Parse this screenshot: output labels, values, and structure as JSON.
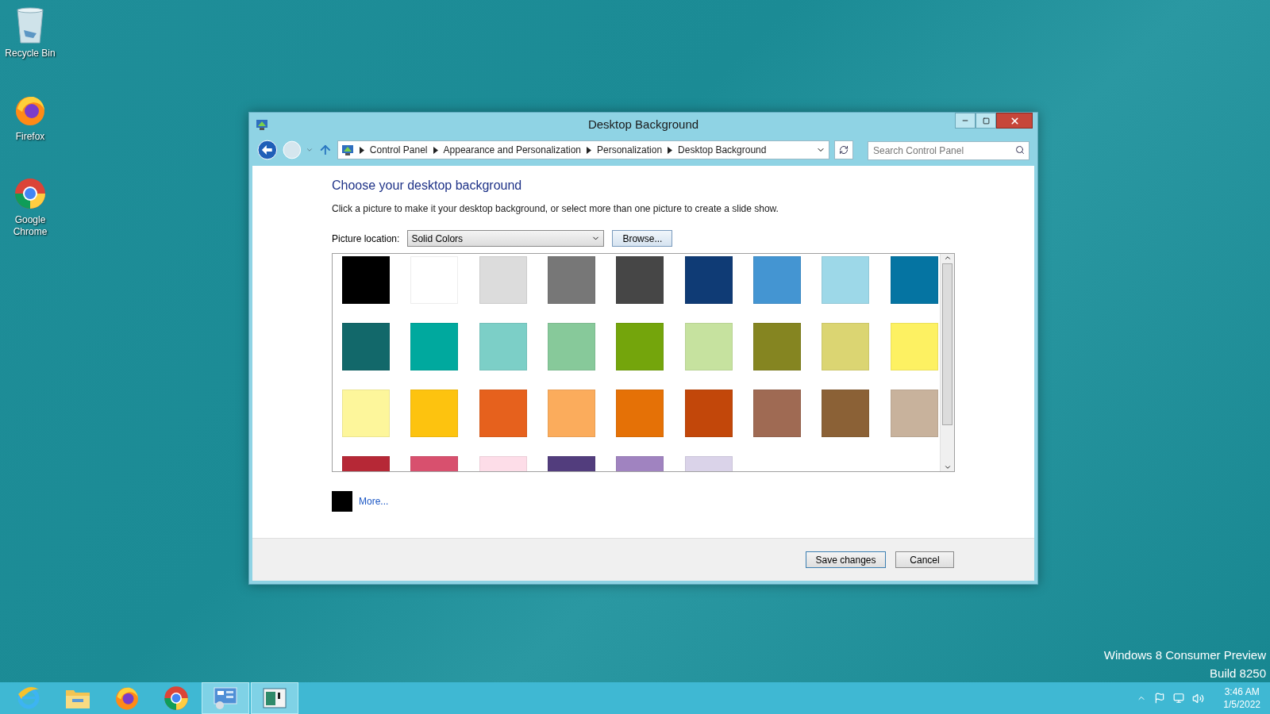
{
  "desktop_icons": [
    {
      "kind": "recycle-bin",
      "label": "Recycle Bin"
    },
    {
      "kind": "firefox",
      "label": "Firefox"
    },
    {
      "kind": "chrome",
      "label": "Google Chrome"
    }
  ],
  "window": {
    "title": "Desktop Background",
    "breadcrumbs": [
      "Control Panel",
      "Appearance and Personalization",
      "Personalization",
      "Desktop Background"
    ],
    "search": {
      "placeholder": "Search Control Panel"
    },
    "heading": "Choose your desktop background",
    "description": "Click a picture to make it your desktop background, or select more than one picture to create a slide show.",
    "location": {
      "label": "Picture location:",
      "value": "Solid Colors"
    },
    "browse_button": "Browse...",
    "swatches": [
      {
        "color": "#000000"
      },
      {
        "color": "#ffffff"
      },
      {
        "color": "#dcdcdc"
      },
      {
        "color": "#777777"
      },
      {
        "color": "#464646"
      },
      {
        "color": "#0f3b75"
      },
      {
        "color": "#4495d2"
      },
      {
        "color": "#9dd8e8"
      },
      {
        "color": "#0574a2"
      },
      {
        "color": "#12686a"
      },
      {
        "color": "#00a99e"
      },
      {
        "color": "#7ccfc7"
      },
      {
        "color": "#87c99a"
      },
      {
        "color": "#74a50c"
      },
      {
        "color": "#c6e29f"
      },
      {
        "color": "#858521"
      },
      {
        "color": "#dbd572"
      },
      {
        "color": "#fdf162"
      },
      {
        "color": "#fdf69b"
      },
      {
        "color": "#fdc30f"
      },
      {
        "color": "#e6611d"
      },
      {
        "color": "#fbac5c"
      },
      {
        "color": "#e57106"
      },
      {
        "color": "#c2470a"
      },
      {
        "color": "#9f6a53"
      },
      {
        "color": "#8b6136"
      },
      {
        "color": "#c8b29c"
      },
      {
        "color": "#b62836"
      },
      {
        "color": "#d8506e"
      },
      {
        "color": "#fddde8"
      },
      {
        "color": "#523d7d"
      },
      {
        "color": "#a083c0"
      },
      {
        "color": "#dad3e9"
      }
    ],
    "more": {
      "color": "#000000",
      "link": "More..."
    },
    "buttons": [
      "Save changes",
      "Cancel"
    ]
  },
  "os_notice": [
    "Windows 8 Consumer Preview",
    "Build 8250"
  ],
  "taskbar": {
    "apps": [
      {
        "kind": "ie",
        "active": false
      },
      {
        "kind": "explorer",
        "active": false
      },
      {
        "kind": "firefox",
        "active": false
      },
      {
        "kind": "chrome",
        "active": false
      },
      {
        "kind": "control-panel",
        "active": true
      },
      {
        "kind": "app",
        "active": true
      }
    ],
    "clock": {
      "time": "3:46 AM",
      "date": "1/5/2022"
    }
  }
}
